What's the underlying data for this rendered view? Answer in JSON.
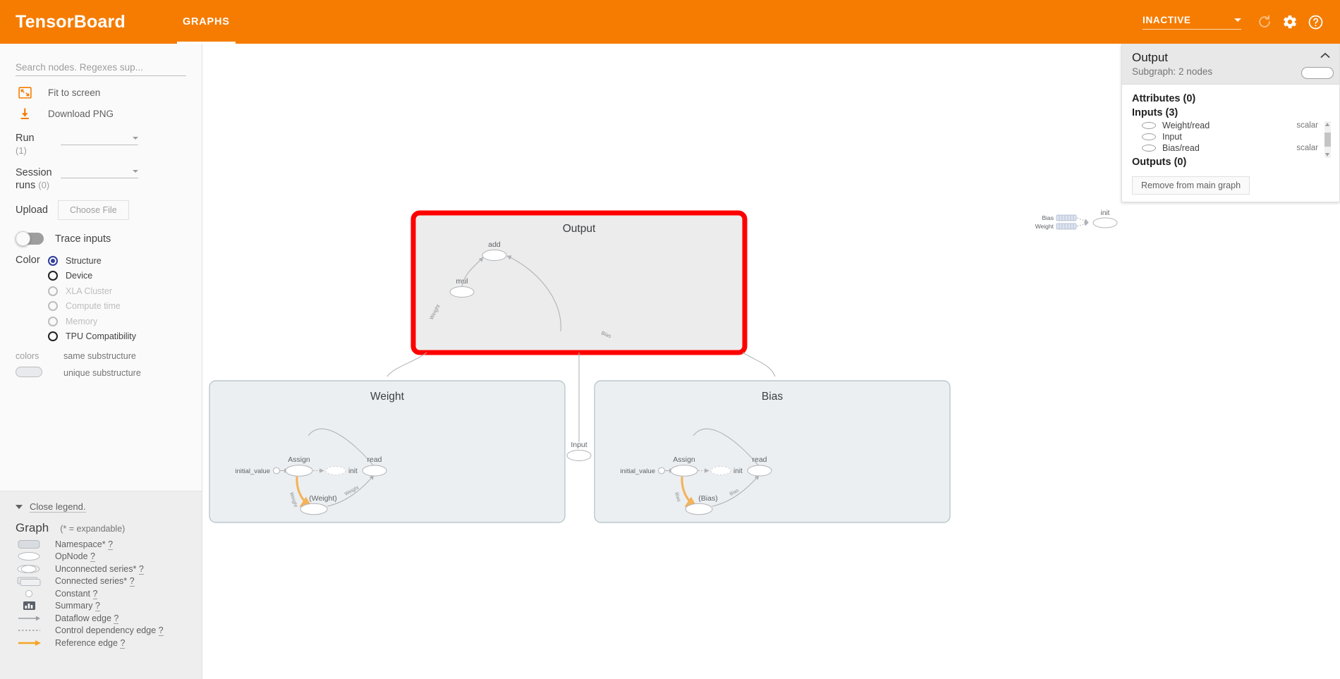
{
  "header": {
    "brand": "TensorBoard",
    "tabs": [
      {
        "label": "GRAPHS",
        "active": true
      }
    ],
    "status": "INACTIVE",
    "icons": [
      "refresh-icon",
      "gear-icon",
      "help-icon"
    ],
    "accent": "#f57c00"
  },
  "sidebar": {
    "search": {
      "placeholder": "Search nodes. Regexes sup...",
      "value": ""
    },
    "actions": [
      {
        "label": "Fit to screen",
        "icon": "fit-to-screen-icon"
      },
      {
        "label": "Download PNG",
        "icon": "download-icon"
      }
    ],
    "run": {
      "label": "Run",
      "count": "(1)",
      "value": ""
    },
    "session_runs": {
      "label": "Session runs",
      "count": "(0)",
      "value": ""
    },
    "upload": {
      "label": "Upload",
      "button": "Choose File"
    },
    "trace_inputs": {
      "label": "Trace inputs",
      "on": false
    },
    "color": {
      "label": "Color",
      "options": [
        {
          "label": "Structure",
          "state": "selected"
        },
        {
          "label": "Device",
          "state": "enabled"
        },
        {
          "label": "XLA Cluster",
          "state": "disabled"
        },
        {
          "label": "Compute time",
          "state": "disabled"
        },
        {
          "label": "Memory",
          "state": "disabled"
        },
        {
          "label": "TPU Compatibility",
          "state": "enabled"
        }
      ],
      "colors_key": "colors",
      "same_substructure": "same substructure",
      "unique_substructure": "unique substructure"
    }
  },
  "legend": {
    "close_label": "Close legend.",
    "title": "Graph",
    "note": "(* = expandable)",
    "items": [
      {
        "label": "Namespace*",
        "help": "?",
        "icon": "namespace-icon"
      },
      {
        "label": "OpNode",
        "help": "?",
        "icon": "opnode-icon"
      },
      {
        "label": "Unconnected series*",
        "help": "?",
        "icon": "unconnected-series-icon"
      },
      {
        "label": "Connected series*",
        "help": "?",
        "icon": "connected-series-icon"
      },
      {
        "label": "Constant",
        "help": "?",
        "icon": "constant-icon"
      },
      {
        "label": "Summary",
        "help": "?",
        "icon": "summary-icon"
      },
      {
        "label": "Dataflow edge",
        "help": "?",
        "icon": "dataflow-edge-icon"
      },
      {
        "label": "Control dependency edge",
        "help": "?",
        "icon": "control-dependency-edge-icon"
      },
      {
        "label": "Reference edge",
        "help": "?",
        "icon": "reference-edge-icon"
      }
    ]
  },
  "info_panel": {
    "title": "Output",
    "subtitle": "Subgraph: 2 nodes",
    "attributes_label": "Attributes (0)",
    "inputs_label": "Inputs (3)",
    "inputs": [
      {
        "name": "Weight/read",
        "type": "scalar"
      },
      {
        "name": "Input",
        "type": ""
      },
      {
        "name": "Bias/read",
        "type": "scalar"
      }
    ],
    "outputs_label": "Outputs (0)",
    "remove_button": "Remove from main graph"
  },
  "graph": {
    "highlight_color": "#ff0000",
    "groups": [
      {
        "name": "Output",
        "selected": true,
        "fill": "#ececec"
      },
      {
        "name": "Weight",
        "selected": false,
        "fill": "#eceff1"
      },
      {
        "name": "Bias",
        "selected": false,
        "fill": "#eceff1"
      }
    ],
    "output_nodes": [
      {
        "label": "add"
      },
      {
        "label": "mul"
      }
    ],
    "output_edge_labels": [
      "Weight",
      "Input",
      "Bias"
    ],
    "input_node": "Input",
    "weight_nodes": {
      "initial_value": "initial_value",
      "assign": "Assign",
      "init": "init",
      "variable": "(Weight)",
      "read": "read",
      "edge_assign": "Weight",
      "edge_read": "Weight"
    },
    "bias_nodes": {
      "initial_value": "initial_value",
      "assign": "Assign",
      "init": "init",
      "variable": "(Bias)",
      "read": "read",
      "edge_assign": "Bias",
      "edge_read": "Bias"
    },
    "minimap": {
      "rows": [
        "Bias",
        "Weight"
      ],
      "target": "init"
    }
  }
}
